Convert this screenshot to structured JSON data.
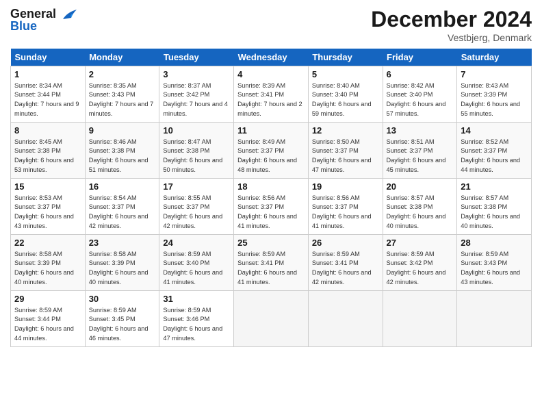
{
  "header": {
    "logo_line1": "General",
    "logo_line2": "Blue",
    "month_title": "December 2024",
    "location": "Vestbjerg, Denmark"
  },
  "days_of_week": [
    "Sunday",
    "Monday",
    "Tuesday",
    "Wednesday",
    "Thursday",
    "Friday",
    "Saturday"
  ],
  "weeks": [
    [
      {
        "day": "1",
        "sunrise": "Sunrise: 8:34 AM",
        "sunset": "Sunset: 3:44 PM",
        "daylight": "Daylight: 7 hours and 9 minutes."
      },
      {
        "day": "2",
        "sunrise": "Sunrise: 8:35 AM",
        "sunset": "Sunset: 3:43 PM",
        "daylight": "Daylight: 7 hours and 7 minutes."
      },
      {
        "day": "3",
        "sunrise": "Sunrise: 8:37 AM",
        "sunset": "Sunset: 3:42 PM",
        "daylight": "Daylight: 7 hours and 4 minutes."
      },
      {
        "day": "4",
        "sunrise": "Sunrise: 8:39 AM",
        "sunset": "Sunset: 3:41 PM",
        "daylight": "Daylight: 7 hours and 2 minutes."
      },
      {
        "day": "5",
        "sunrise": "Sunrise: 8:40 AM",
        "sunset": "Sunset: 3:40 PM",
        "daylight": "Daylight: 6 hours and 59 minutes."
      },
      {
        "day": "6",
        "sunrise": "Sunrise: 8:42 AM",
        "sunset": "Sunset: 3:40 PM",
        "daylight": "Daylight: 6 hours and 57 minutes."
      },
      {
        "day": "7",
        "sunrise": "Sunrise: 8:43 AM",
        "sunset": "Sunset: 3:39 PM",
        "daylight": "Daylight: 6 hours and 55 minutes."
      }
    ],
    [
      {
        "day": "8",
        "sunrise": "Sunrise: 8:45 AM",
        "sunset": "Sunset: 3:38 PM",
        "daylight": "Daylight: 6 hours and 53 minutes."
      },
      {
        "day": "9",
        "sunrise": "Sunrise: 8:46 AM",
        "sunset": "Sunset: 3:38 PM",
        "daylight": "Daylight: 6 hours and 51 minutes."
      },
      {
        "day": "10",
        "sunrise": "Sunrise: 8:47 AM",
        "sunset": "Sunset: 3:38 PM",
        "daylight": "Daylight: 6 hours and 50 minutes."
      },
      {
        "day": "11",
        "sunrise": "Sunrise: 8:49 AM",
        "sunset": "Sunset: 3:37 PM",
        "daylight": "Daylight: 6 hours and 48 minutes."
      },
      {
        "day": "12",
        "sunrise": "Sunrise: 8:50 AM",
        "sunset": "Sunset: 3:37 PM",
        "daylight": "Daylight: 6 hours and 47 minutes."
      },
      {
        "day": "13",
        "sunrise": "Sunrise: 8:51 AM",
        "sunset": "Sunset: 3:37 PM",
        "daylight": "Daylight: 6 hours and 45 minutes."
      },
      {
        "day": "14",
        "sunrise": "Sunrise: 8:52 AM",
        "sunset": "Sunset: 3:37 PM",
        "daylight": "Daylight: 6 hours and 44 minutes."
      }
    ],
    [
      {
        "day": "15",
        "sunrise": "Sunrise: 8:53 AM",
        "sunset": "Sunset: 3:37 PM",
        "daylight": "Daylight: 6 hours and 43 minutes."
      },
      {
        "day": "16",
        "sunrise": "Sunrise: 8:54 AM",
        "sunset": "Sunset: 3:37 PM",
        "daylight": "Daylight: 6 hours and 42 minutes."
      },
      {
        "day": "17",
        "sunrise": "Sunrise: 8:55 AM",
        "sunset": "Sunset: 3:37 PM",
        "daylight": "Daylight: 6 hours and 42 minutes."
      },
      {
        "day": "18",
        "sunrise": "Sunrise: 8:56 AM",
        "sunset": "Sunset: 3:37 PM",
        "daylight": "Daylight: 6 hours and 41 minutes."
      },
      {
        "day": "19",
        "sunrise": "Sunrise: 8:56 AM",
        "sunset": "Sunset: 3:37 PM",
        "daylight": "Daylight: 6 hours and 41 minutes."
      },
      {
        "day": "20",
        "sunrise": "Sunrise: 8:57 AM",
        "sunset": "Sunset: 3:38 PM",
        "daylight": "Daylight: 6 hours and 40 minutes."
      },
      {
        "day": "21",
        "sunrise": "Sunrise: 8:57 AM",
        "sunset": "Sunset: 3:38 PM",
        "daylight": "Daylight: 6 hours and 40 minutes."
      }
    ],
    [
      {
        "day": "22",
        "sunrise": "Sunrise: 8:58 AM",
        "sunset": "Sunset: 3:39 PM",
        "daylight": "Daylight: 6 hours and 40 minutes."
      },
      {
        "day": "23",
        "sunrise": "Sunrise: 8:58 AM",
        "sunset": "Sunset: 3:39 PM",
        "daylight": "Daylight: 6 hours and 40 minutes."
      },
      {
        "day": "24",
        "sunrise": "Sunrise: 8:59 AM",
        "sunset": "Sunset: 3:40 PM",
        "daylight": "Daylight: 6 hours and 41 minutes."
      },
      {
        "day": "25",
        "sunrise": "Sunrise: 8:59 AM",
        "sunset": "Sunset: 3:41 PM",
        "daylight": "Daylight: 6 hours and 41 minutes."
      },
      {
        "day": "26",
        "sunrise": "Sunrise: 8:59 AM",
        "sunset": "Sunset: 3:41 PM",
        "daylight": "Daylight: 6 hours and 42 minutes."
      },
      {
        "day": "27",
        "sunrise": "Sunrise: 8:59 AM",
        "sunset": "Sunset: 3:42 PM",
        "daylight": "Daylight: 6 hours and 42 minutes."
      },
      {
        "day": "28",
        "sunrise": "Sunrise: 8:59 AM",
        "sunset": "Sunset: 3:43 PM",
        "daylight": "Daylight: 6 hours and 43 minutes."
      }
    ],
    [
      {
        "day": "29",
        "sunrise": "Sunrise: 8:59 AM",
        "sunset": "Sunset: 3:44 PM",
        "daylight": "Daylight: 6 hours and 44 minutes."
      },
      {
        "day": "30",
        "sunrise": "Sunrise: 8:59 AM",
        "sunset": "Sunset: 3:45 PM",
        "daylight": "Daylight: 6 hours and 46 minutes."
      },
      {
        "day": "31",
        "sunrise": "Sunrise: 8:59 AM",
        "sunset": "Sunset: 3:46 PM",
        "daylight": "Daylight: 6 hours and 47 minutes."
      },
      null,
      null,
      null,
      null
    ]
  ]
}
